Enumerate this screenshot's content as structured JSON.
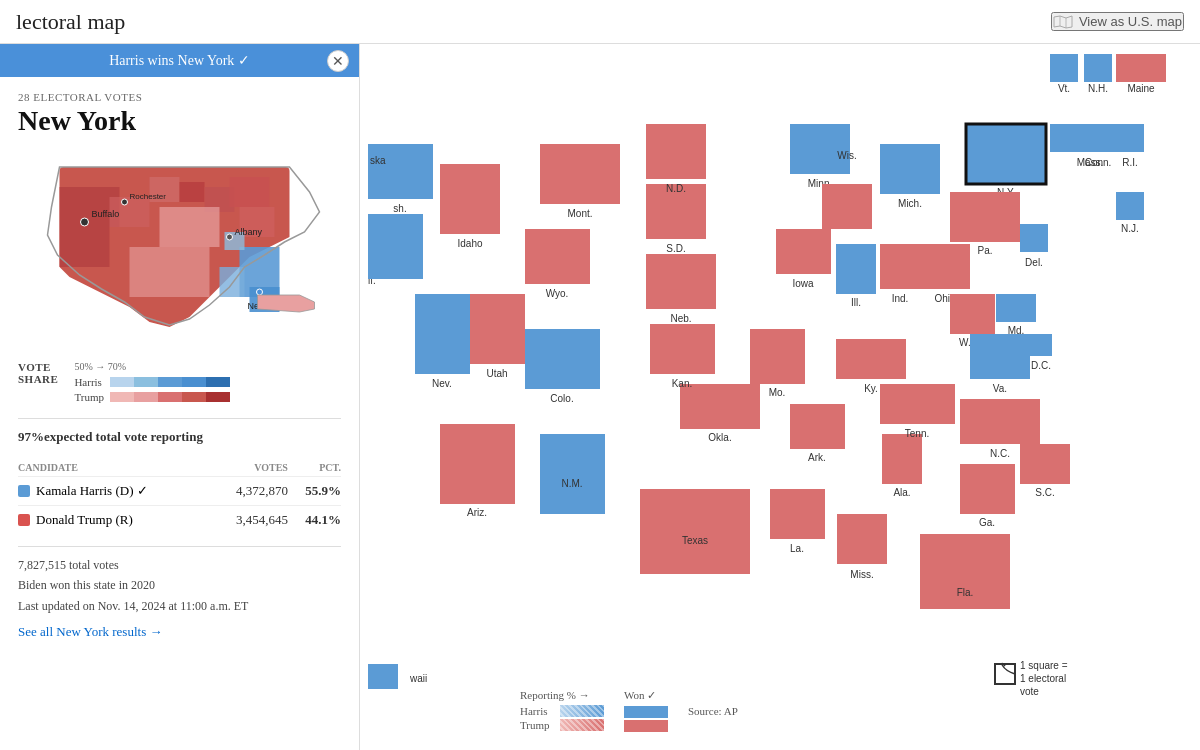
{
  "header": {
    "title": "lectoral map",
    "view_map_label": "View as U.S. map"
  },
  "sidebar": {
    "banner_text": "Harris wins New York ✓",
    "electoral_votes_label": "28 ELECTORAL VOTES",
    "state_name": "New York",
    "vote_share_title": "VOTE SHARE",
    "vote_share_scale": "50% → 70%",
    "harris_label": "Harris",
    "trump_label": "Trump",
    "reporting_pct": "97%",
    "reporting_text": "expected total vote reporting",
    "candidate_col": "CANDIDATE",
    "votes_col": "VOTES",
    "pct_col": "PCT.",
    "candidates": [
      {
        "name": "Kamala Harris (D) ✓",
        "party": "D",
        "votes": "4,372,870",
        "pct": "55.9%",
        "winner": true
      },
      {
        "name": "Donald Trump (R)",
        "party": "R",
        "votes": "3,454,645",
        "pct": "44.1%",
        "winner": false
      }
    ],
    "total_votes": "7,827,515 total votes",
    "prev_winner": "Biden won this state in 2020",
    "last_updated": "Last updated on Nov. 14, 2024 at 11:00 a.m. ET",
    "see_all_link": "See all New York results →"
  },
  "map_legend": {
    "reporting_label": "Reporting % →",
    "won_label": "Won ✓",
    "harris_label": "Harris",
    "trump_label": "Trump",
    "source_label": "Source: AP"
  },
  "square_note": {
    "label": "1 square = 1 electoral vote"
  },
  "states": {
    "highlighted": "New York"
  }
}
